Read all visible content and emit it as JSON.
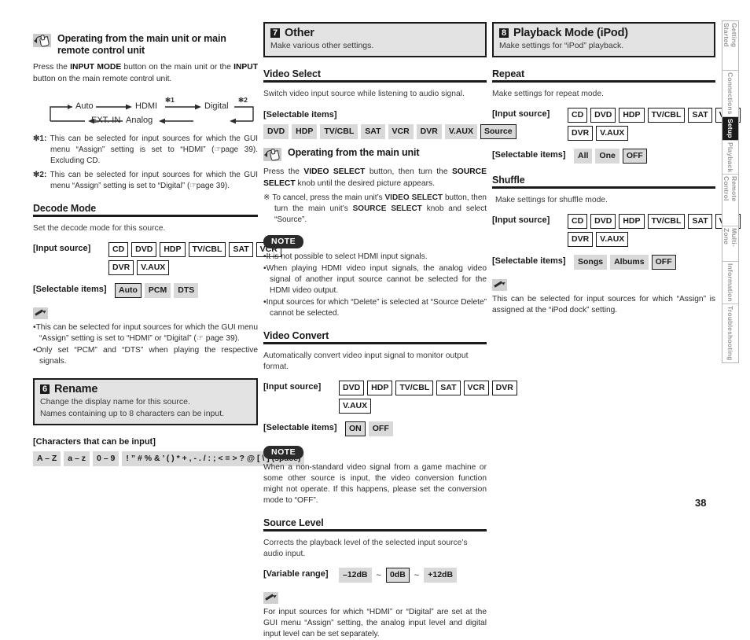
{
  "page_number": "38",
  "side_tabs": [
    {
      "label": "Getting Started",
      "active": false
    },
    {
      "label": "Connections",
      "active": false
    },
    {
      "label": "Setup",
      "active": true
    },
    {
      "label": "Playback",
      "active": false
    },
    {
      "label": "Remote Control",
      "active": false
    },
    {
      "label": "Multi-Zone",
      "active": false
    },
    {
      "label": "Information",
      "active": false
    },
    {
      "label": "Troubleshooting",
      "active": false
    }
  ],
  "column1": {
    "operating_heading": "Operating from the main unit or main remote control unit",
    "operating_body_1": "Press the ",
    "operating_body_b1": "INPUT MODE",
    "operating_body_2": " button on the main unit or the ",
    "operating_body_b2": "INPUT",
    "operating_body_3": " button on the main remote control unit.",
    "flow": {
      "nodes": [
        "Auto",
        "HDMI",
        "Digital",
        "Analog",
        "EXT. IN"
      ],
      "marks": [
        "✻1",
        "✻2"
      ]
    },
    "footnote_1_label": "✻1:",
    "footnote_1_text_a": "This can be selected for input sources for which the GUI menu “Assign” setting is set to “HDMI” (",
    "footnote_1_ref": "page 39",
    "footnote_1_text_b": "). Excluding CD.",
    "footnote_2_label": "✻2:",
    "footnote_2_text_a": "This can be selected for input sources for which the GUI menu “Assign” setting is set to “Digital” (",
    "footnote_2_ref": "page 39",
    "footnote_2_text_b": ").",
    "decode_mode": {
      "heading": "Decode Mode",
      "description": "Set the decode mode for this source.",
      "input_source_label": "[Input source]",
      "input_sources_row1": [
        "CD",
        "DVD",
        "HDP",
        "TV/CBL",
        "SAT",
        "VCR"
      ],
      "input_sources_row2": [
        "DVR",
        "V.AUX"
      ],
      "selectable_label": "[Selectable items]",
      "selectable_items": [
        {
          "label": "Auto",
          "default": true
        },
        {
          "label": "PCM",
          "default": false
        },
        {
          "label": "DTS",
          "default": false
        }
      ],
      "notes": [
        "This can be selected for input sources for which the GUI menu “Assign” setting is set to “HDMI” or “Digital” (☞ page 39).",
        "Only set “PCM” and “DTS” when playing the respective signals."
      ]
    },
    "rename": {
      "number": "6",
      "title": "Rename",
      "sub_line1": "Change the display name for this source.",
      "sub_line2": "Names containing up to 8 characters can be input.",
      "chars_label": "[Characters that can be input]",
      "char_sets": [
        "A – Z",
        "a – z",
        "0 – 9",
        "! ” # % & ’ ( ) * + , - . / : ; < = > ? @ [ \\ ]  (space)"
      ]
    }
  },
  "column2": {
    "banner": {
      "number": "7",
      "title": "Other",
      "subtitle": "Make various other settings."
    },
    "video_select": {
      "heading": "Video Select",
      "description": "Switch video input source while listening to audio signal.",
      "selectable_label": "[Selectable items]",
      "selectable_items": [
        {
          "label": "DVD",
          "default": false
        },
        {
          "label": "HDP",
          "default": false
        },
        {
          "label": "TV/CBL",
          "default": false
        },
        {
          "label": "SAT",
          "default": false
        },
        {
          "label": "VCR",
          "default": false
        },
        {
          "label": "DVR",
          "default": false
        },
        {
          "label": "V.AUX",
          "default": false
        },
        {
          "label": "Source",
          "default": true
        }
      ],
      "operating_heading": "Operating from the main unit",
      "operating_body_1": "Press the ",
      "operating_body_b1": "VIDEO SELECT",
      "operating_body_2": " button, then turn the ",
      "operating_body_b2": "SOURCE SELECT",
      "operating_body_3": " knob until the desired picture appears.",
      "cancel_sym": "※",
      "cancel_text_1": "To cancel, press the main unit’s ",
      "cancel_b1": "VIDEO SELECT",
      "cancel_text_2": " button, then turn the main unit’s ",
      "cancel_b2": "SOURCE SELECT",
      "cancel_text_3": " knob and select “Source”.",
      "note_badge": "NOTE",
      "notes": [
        "It is not possible to select HDMI input signals.",
        "When playing HDMI video input signals, the analog video signal of another input source cannot be selected for the HDMI video output.",
        "Input sources for which “Delete” is selected at “Source Delete” cannot be selected."
      ]
    },
    "video_convert": {
      "heading": "Video Convert",
      "description": "Automatically convert video input signal to monitor output format.",
      "input_source_label": "[Input source]",
      "input_sources_row1": [
        "DVD",
        "HDP",
        "TV/CBL",
        "SAT",
        "VCR",
        "DVR"
      ],
      "input_sources_row2": [
        "V.AUX"
      ],
      "selectable_label": "[Selectable items]",
      "selectable_items": [
        {
          "label": "ON",
          "default": true
        },
        {
          "label": "OFF",
          "default": false
        }
      ],
      "note_badge": "NOTE",
      "note_text": "When a non-standard video signal from a game machine or some other source is input, the video conversion function might not operate. If this happens, please set the conversion mode to “OFF”."
    },
    "source_level": {
      "heading": "Source Level",
      "description": "Corrects the playback level of the selected input source’s audio input.",
      "range_label": "[Variable range]",
      "range_min": "–12dB",
      "range_mid": "0dB",
      "range_max": "+12dB",
      "tilde": "~",
      "note": "For input sources for which “HDMI” or “Digital” are set at the GUI menu “Assign” setting, the analog input level and digital input level can be set separately."
    }
  },
  "column3": {
    "banner": {
      "number": "8",
      "title": "Playback Mode (iPod)",
      "subtitle": "Make settings for “iPod” playback."
    },
    "repeat": {
      "heading": "Repeat",
      "description": "Make settings for repeat mode.",
      "input_source_label": "[Input source]",
      "input_sources_row1": [
        "CD",
        "DVD",
        "HDP",
        "TV/CBL",
        "SAT",
        "VCR"
      ],
      "input_sources_row2": [
        "DVR",
        "V.AUX"
      ],
      "selectable_label": "[Selectable items]",
      "selectable_items": [
        {
          "label": "All",
          "default": false
        },
        {
          "label": "One",
          "default": false
        },
        {
          "label": "OFF",
          "default": true
        }
      ]
    },
    "shuffle": {
      "heading": "Shuffle",
      "description": "Make settings for shuffle mode.",
      "input_source_label": "[Input source]",
      "input_sources_row1": [
        "CD",
        "DVD",
        "HDP",
        "TV/CBL",
        "SAT",
        "VCR"
      ],
      "input_sources_row2": [
        "DVR",
        "V.AUX"
      ],
      "selectable_label": "[Selectable items]",
      "selectable_items": [
        {
          "label": "Songs",
          "default": false
        },
        {
          "label": "Albums",
          "default": false
        },
        {
          "label": "OFF",
          "default": true
        }
      ],
      "note": "This can be selected for input sources for which “Assign” is assigned at the “iPod dock” setting."
    }
  }
}
